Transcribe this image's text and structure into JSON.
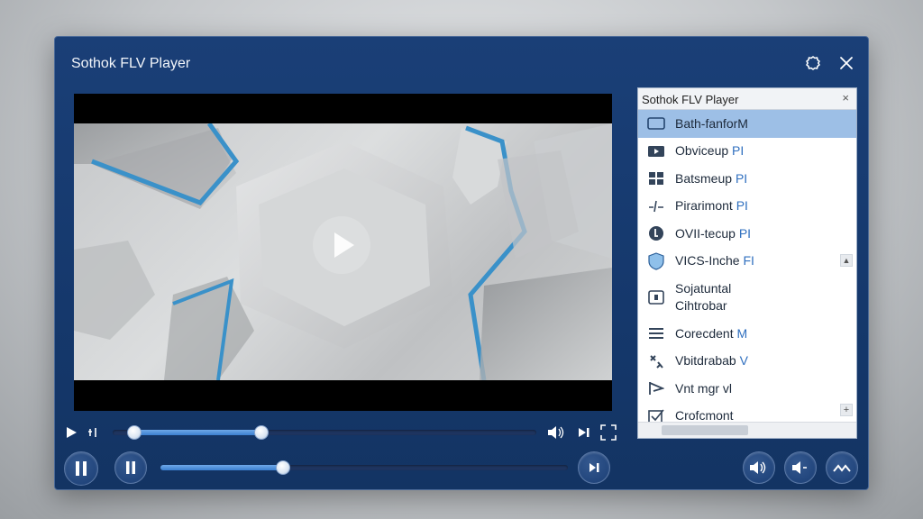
{
  "app": {
    "title": "Sothok FLV Player"
  },
  "panel": {
    "title": "Sothok FLV Player",
    "close": "×",
    "scroll_up": "▲",
    "scroll_down": "+",
    "items": [
      {
        "label": "Bath-fanforM",
        "icon": "window-icon",
        "selected": true
      },
      {
        "label": "Obviceup",
        "suffix": "PI",
        "icon": "video-icon"
      },
      {
        "label": "Batsmeup",
        "suffix": "PI",
        "icon": "grid-icon"
      },
      {
        "label": "Pirarimont",
        "suffix": "PI",
        "icon": "pulse-icon"
      },
      {
        "label": "OVII-tecup",
        "suffix": "PI",
        "icon": "badge-icon"
      },
      {
        "label": "VICS-Inche",
        "suffix": "FI",
        "icon": "shield-icon"
      },
      {
        "label": "Sojatuntal",
        "label2": "Cihtrobar",
        "icon": "square-icon"
      },
      {
        "label": "Corecdent",
        "suffix": "M",
        "icon": "list-icon"
      },
      {
        "label": "Vbitdrabab",
        "suffix": "V",
        "icon": "tools-icon"
      },
      {
        "label": "Vnt mgr vl",
        "icon": "cursor-icon"
      },
      {
        "label": "Crofcmont",
        "icon": "checkbox-icon"
      }
    ]
  },
  "player": {
    "seek_progress": 0.35,
    "volume_level": 0.3,
    "range_start": 0.05
  },
  "colors": {
    "window": "#15386c",
    "accent": "#3b7fd0",
    "selection": "#9dbfe6"
  }
}
